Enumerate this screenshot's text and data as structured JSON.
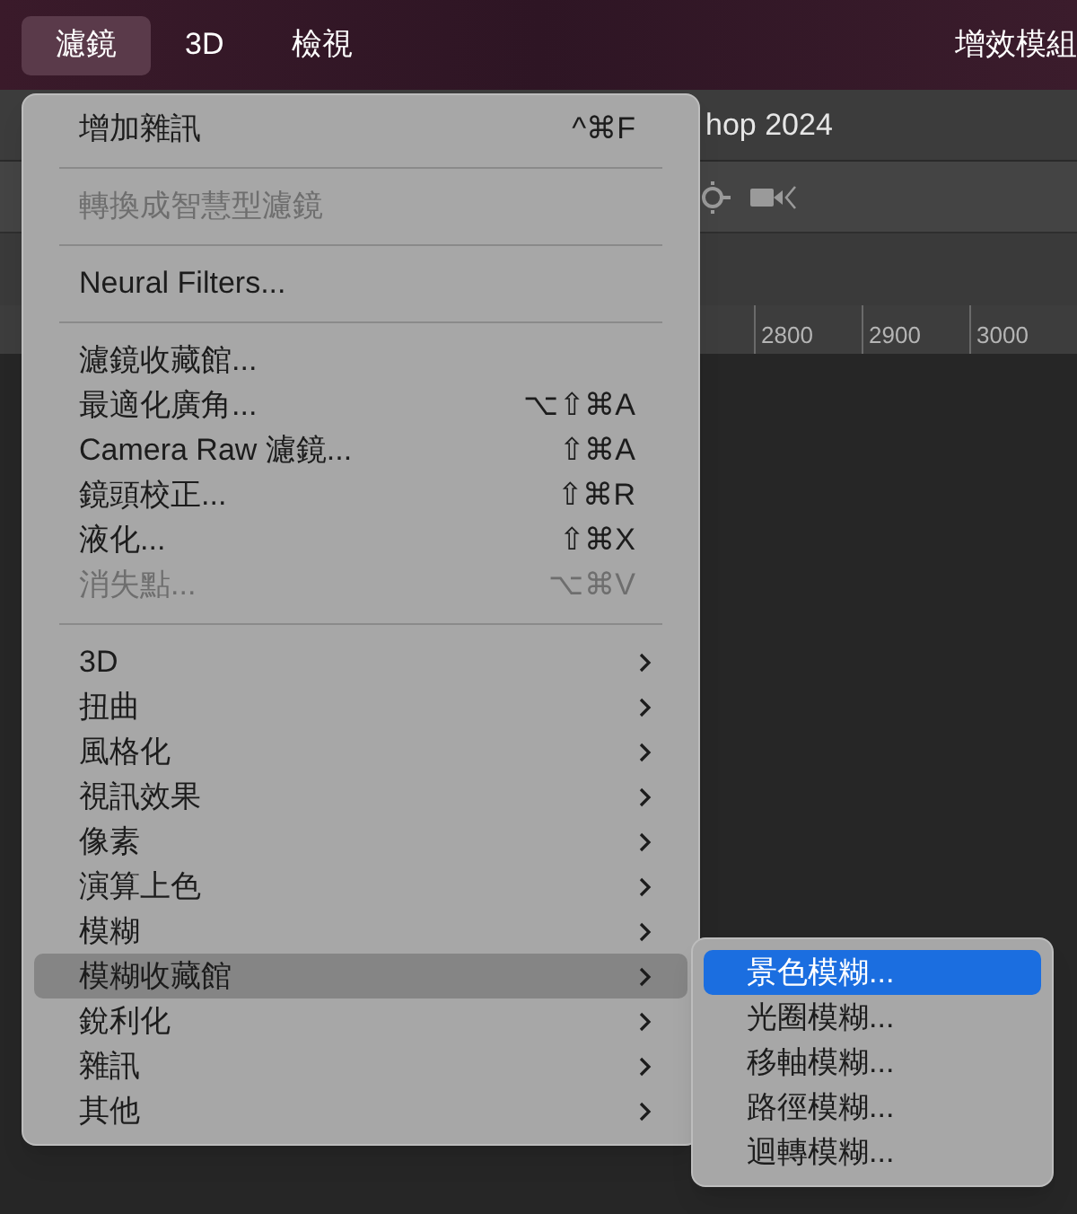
{
  "menubar": {
    "items": [
      {
        "label": "濾鏡",
        "selected": true
      },
      {
        "label": "3D",
        "selected": false
      },
      {
        "label": "檢視",
        "selected": false
      }
    ],
    "right_label": "增效模組"
  },
  "app_title": "hop 2024",
  "ruler": {
    "ticks": [
      "2800",
      "2900",
      "3000"
    ]
  },
  "menu": {
    "sections": [
      [
        {
          "kind": "action",
          "label": "增加雜訊",
          "shortcut": "^⌘F",
          "disabled": false,
          "selected": false
        }
      ],
      [
        {
          "kind": "action",
          "label": "轉換成智慧型濾鏡",
          "disabled": true,
          "selected": false
        }
      ],
      [
        {
          "kind": "action",
          "label": "Neural Filters...",
          "disabled": false,
          "selected": false
        }
      ],
      [
        {
          "kind": "action",
          "label": "濾鏡收藏館...",
          "disabled": false,
          "selected": false
        },
        {
          "kind": "action",
          "label": "最適化廣角...",
          "shortcut": "⌥⇧⌘A",
          "disabled": false,
          "selected": false
        },
        {
          "kind": "action",
          "label": "Camera Raw 濾鏡...",
          "shortcut": "⇧⌘A",
          "disabled": false,
          "selected": false
        },
        {
          "kind": "action",
          "label": "鏡頭校正...",
          "shortcut": "⇧⌘R",
          "disabled": false,
          "selected": false
        },
        {
          "kind": "action",
          "label": "液化...",
          "shortcut": "⇧⌘X",
          "disabled": false,
          "selected": false
        },
        {
          "kind": "action",
          "label": "消失點...",
          "shortcut": "⌥⌘V",
          "disabled": true,
          "selected": false
        }
      ],
      [
        {
          "kind": "submenu",
          "label": "3D",
          "selected": false
        },
        {
          "kind": "submenu",
          "label": "扭曲",
          "selected": false
        },
        {
          "kind": "submenu",
          "label": "風格化",
          "selected": false
        },
        {
          "kind": "submenu",
          "label": "視訊效果",
          "selected": false
        },
        {
          "kind": "submenu",
          "label": "像素",
          "selected": false
        },
        {
          "kind": "submenu",
          "label": "演算上色",
          "selected": false
        },
        {
          "kind": "submenu",
          "label": "模糊",
          "selected": false
        },
        {
          "kind": "submenu",
          "label": "模糊收藏館",
          "selected": true
        },
        {
          "kind": "submenu",
          "label": "銳利化",
          "selected": false
        },
        {
          "kind": "submenu",
          "label": "雜訊",
          "selected": false
        },
        {
          "kind": "submenu",
          "label": "其他",
          "selected": false
        }
      ]
    ]
  },
  "submenu": {
    "items": [
      {
        "label": "景色模糊...",
        "selected": true
      },
      {
        "label": "光圈模糊...",
        "selected": false
      },
      {
        "label": "移軸模糊...",
        "selected": false
      },
      {
        "label": "路徑模糊...",
        "selected": false
      },
      {
        "label": "迴轉模糊...",
        "selected": false
      }
    ]
  }
}
